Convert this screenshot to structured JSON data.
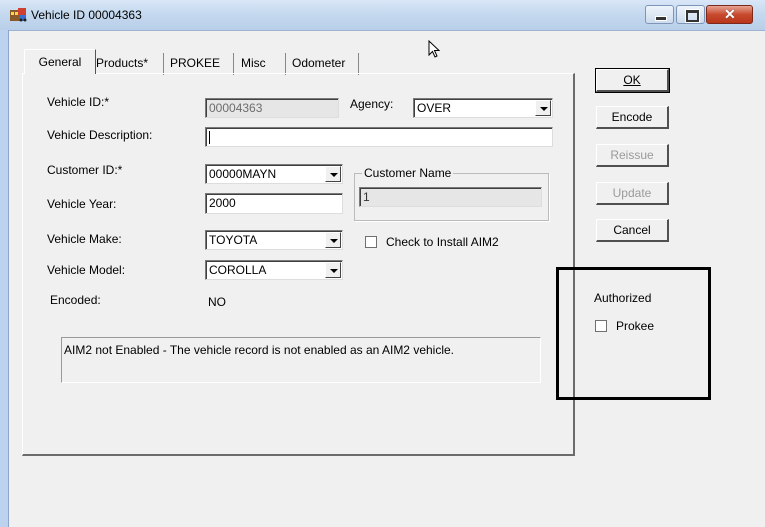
{
  "window": {
    "title": "Vehicle ID 00004363"
  },
  "tabs": [
    {
      "label": "General"
    },
    {
      "label": "Products*"
    },
    {
      "label": "PROKEE"
    },
    {
      "label": "Misc"
    },
    {
      "label": "Odometer"
    }
  ],
  "form": {
    "vehicle_id_label": "Vehicle ID:*",
    "vehicle_id_value": "00004363",
    "agency_label": "Agency:",
    "agency_value": "OVER",
    "vehicle_description_label": "Vehicle Description:",
    "vehicle_description_value": "",
    "customer_id_label": "Customer ID:*",
    "customer_id_value": "00000MAYN",
    "customer_name_legend": "Customer Name",
    "customer_name_value": "1",
    "vehicle_year_label": "Vehicle Year:",
    "vehicle_year_value": "2000",
    "vehicle_make_label": "Vehicle Make:",
    "vehicle_make_value": "TOYOTA",
    "install_aim2_label": "Check to Install AIM2",
    "vehicle_model_label": "Vehicle Model:",
    "vehicle_model_value": "COROLLA",
    "encoded_label": "Encoded:",
    "encoded_value": "NO",
    "status_message": "AIM2 not Enabled - The vehicle record is not enabled as an AIM2 vehicle."
  },
  "buttons": {
    "ok": "OK",
    "encode": "Encode",
    "reissue": "Reissue",
    "update": "Update",
    "cancel": "Cancel"
  },
  "authorized": {
    "heading": "Authorized",
    "prokee_label": "Prokee"
  }
}
